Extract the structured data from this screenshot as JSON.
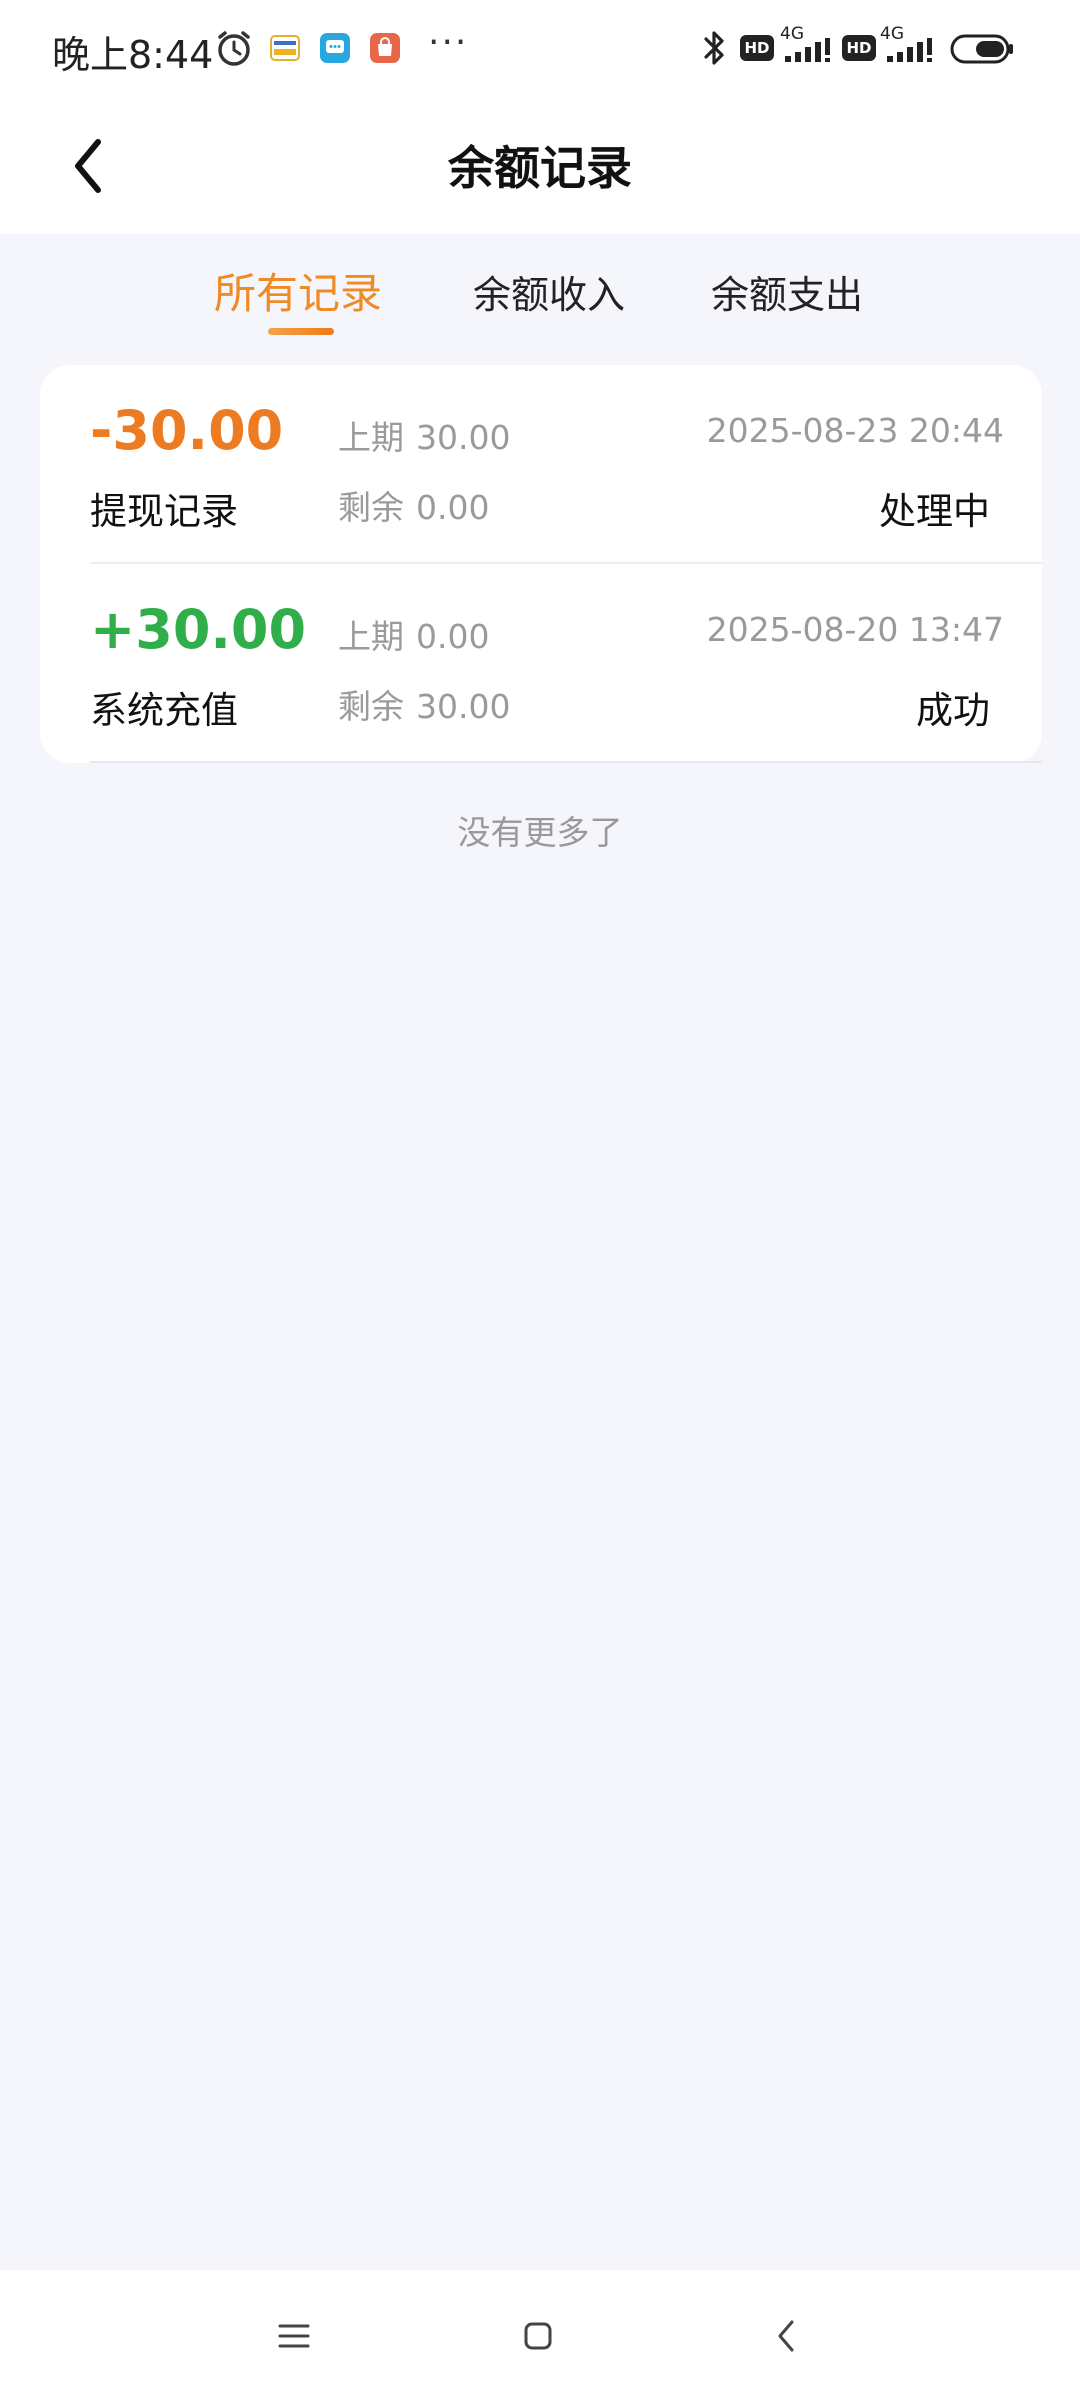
{
  "status_bar": {
    "time": "晚上8:44",
    "more": "···",
    "network_1": "4G",
    "network_2": "4G",
    "hd_1": "HD",
    "hd_2": "HD",
    "icons": [
      "alarm-icon",
      "app-notification-icon",
      "message-app-icon",
      "shop-app-icon",
      "bluetooth-icon",
      "signal-icon",
      "battery-icon"
    ]
  },
  "header": {
    "title": "余额记录",
    "back_icon": "chevron-left-icon"
  },
  "tabs": [
    {
      "label": "所有记录",
      "active": true
    },
    {
      "label": "余额收入",
      "active": false
    },
    {
      "label": "余额支出",
      "active": false
    }
  ],
  "records": [
    {
      "amount": "-30.00",
      "type": "提现记录",
      "prev_label": "上期",
      "prev_value": "30.00",
      "remain_label": "剩余",
      "remain_value": "0.00",
      "time": "2025-08-23 20:44",
      "status": "处理中"
    },
    {
      "amount": "+30.00",
      "type": "系统充值",
      "prev_label": "上期",
      "prev_value": "0.00",
      "remain_label": "剩余",
      "remain_value": "30.00",
      "time": "2025-08-20 13:47",
      "status": "成功"
    }
  ],
  "footer_text": "没有更多了",
  "colors": {
    "accent": "#f08a24",
    "negative": "#ec7b22",
    "positive": "#2fae4a",
    "background": "#f5f6fb"
  },
  "nav_bar": {
    "icons": [
      "menu-icon",
      "home-icon",
      "back-icon"
    ]
  }
}
